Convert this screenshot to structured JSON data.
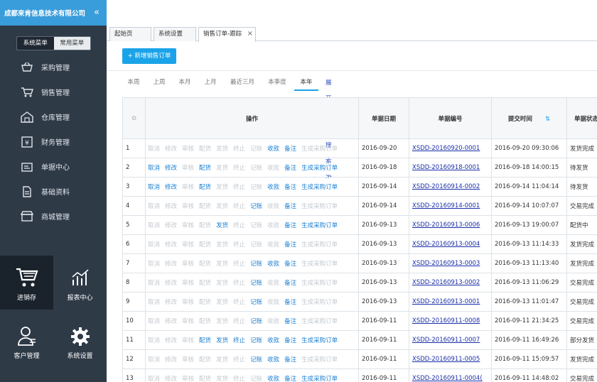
{
  "app": {
    "company": "成都来肯信息技术有限公司",
    "collapse_icon": "«"
  },
  "menu_switch": {
    "system": "系统菜单",
    "common": "常用菜单"
  },
  "nav": [
    {
      "label": "采购管理",
      "icon": "basket-icon"
    },
    {
      "label": "销售管理",
      "icon": "cart-icon"
    },
    {
      "label": "仓库管理",
      "icon": "warehouse-icon"
    },
    {
      "label": "财务管理",
      "icon": "finance-icon"
    },
    {
      "label": "单据中心",
      "icon": "document-center-icon"
    },
    {
      "label": "基础资料",
      "icon": "basic-data-icon"
    },
    {
      "label": "商城管理",
      "icon": "store-icon"
    }
  ],
  "tiles": [
    {
      "label": "进销存",
      "icon": "cart-icon",
      "active": true
    },
    {
      "label": "报表中心",
      "icon": "chart-icon"
    },
    {
      "label": "客户管理",
      "icon": "customer-icon"
    },
    {
      "label": "系统设置",
      "icon": "gear-icon"
    }
  ],
  "tabs": [
    {
      "label": "起始页"
    },
    {
      "label": "系统设置"
    },
    {
      "label": "销售订单-跟踪",
      "close": "×",
      "active": true
    }
  ],
  "toolbar": {
    "new_order": "+ 新增销售订单"
  },
  "filters": [
    "本周",
    "上周",
    "本月",
    "上月",
    "最近三月",
    "本季度",
    "本年"
  ],
  "advanced_search": "展开高级搜索 ≫",
  "table": {
    "headers": {
      "check": "⊙",
      "ops": "操作",
      "date": "单据日期",
      "code": "单据编号",
      "submit": "提交时间",
      "sort": "⇅",
      "status": "单据状态"
    },
    "op_labels": [
      "取消",
      "修改",
      "审核",
      "配货",
      "发货",
      "终止",
      "记账",
      "收款",
      "备注",
      "生成采购订单"
    ],
    "rows": [
      {
        "no": "1",
        "date": "2016-09-20",
        "code": "XSDD-20160920-0001",
        "submit": "2016-09-20 09:30:06",
        "status": "发货完成",
        "enabled": [
          7,
          8
        ]
      },
      {
        "no": "2",
        "date": "2016-09-18",
        "code": "XSDD-20160918-0001",
        "submit": "2016-09-18 14:00:15",
        "status": "待发货",
        "enabled": [
          0,
          1,
          3,
          8,
          9
        ]
      },
      {
        "no": "3",
        "date": "2016-09-14",
        "code": "XSDD-20160914-0002",
        "submit": "2016-09-14 11:04:14",
        "status": "待发货",
        "enabled": [
          0,
          1,
          3,
          7,
          8,
          9
        ]
      },
      {
        "no": "4",
        "date": "2016-09-14",
        "code": "XSDD-20160914-0001",
        "submit": "2016-09-14 10:07:07",
        "status": "交易完成",
        "enabled": [
          6,
          8
        ]
      },
      {
        "no": "5",
        "date": "2016-09-13",
        "code": "XSDD-20160913-0006",
        "submit": "2016-09-13 19:00:07",
        "status": "配货中",
        "enabled": [
          4,
          8,
          9
        ]
      },
      {
        "no": "6",
        "date": "2016-09-13",
        "code": "XSDD-20160913-0004",
        "submit": "2016-09-13 11:14:33",
        "status": "发货完成",
        "enabled": [
          8
        ]
      },
      {
        "no": "7",
        "date": "2016-09-13",
        "code": "XSDD-20160913-0003",
        "submit": "2016-09-13 11:13:40",
        "status": "发货完成",
        "enabled": [
          6,
          7,
          8
        ]
      },
      {
        "no": "8",
        "date": "2016-09-13",
        "code": "XSDD-20160913-0002",
        "submit": "2016-09-13 11:06:29",
        "status": "交易完成",
        "enabled": [
          6,
          8
        ]
      },
      {
        "no": "9",
        "date": "2016-09-13",
        "code": "XSDD-20160913-0001",
        "submit": "2016-09-13 11:01:47",
        "status": "交易完成",
        "enabled": [
          6,
          8
        ]
      },
      {
        "no": "10",
        "date": "2016-09-11",
        "code": "XSDD-20160911-0008",
        "submit": "2016-09-11 21:34:25",
        "status": "交易完成",
        "enabled": [
          6,
          8
        ]
      },
      {
        "no": "11",
        "date": "2016-09-11",
        "code": "XSDD-20160911-0007",
        "submit": "2016-09-11 16:49:26",
        "status": "部分发货",
        "enabled": [
          3,
          4,
          5,
          6,
          7,
          8,
          9
        ]
      },
      {
        "no": "12",
        "date": "2016-09-11",
        "code": "XSDD-20160911-0005",
        "submit": "2016-09-11 15:09:57",
        "status": "发货完成",
        "enabled": [
          6,
          7,
          8
        ]
      },
      {
        "no": "13",
        "date": "2016-09-11",
        "code": "XSDD-20160911-0004(",
        "submit": "2016-09-11 14:48:02",
        "status": "交易完成",
        "enabled": [
          7,
          8,
          9
        ]
      }
    ]
  }
}
